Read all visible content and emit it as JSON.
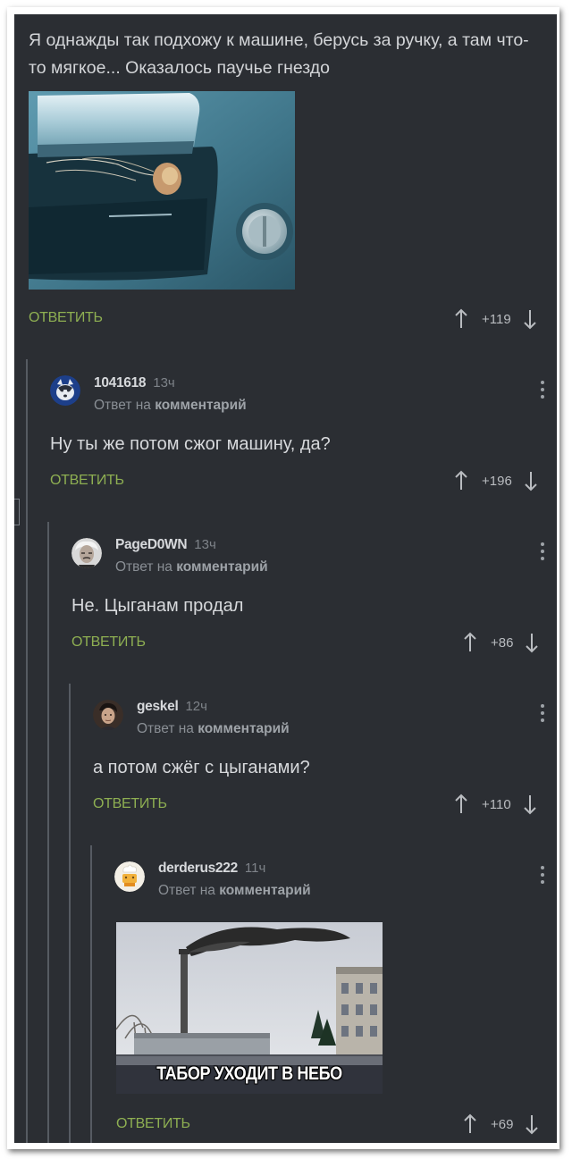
{
  "post": {
    "text": "Я однажды так подхожу к машине, берусь за ручку, а там что-то мягкое... Оказалось паучье гнездо",
    "reply_label": "ОТВЕТИТЬ",
    "rating": "+119"
  },
  "comments": [
    {
      "user": "1041618",
      "time": "13ч",
      "meta_prefix": "Ответ на",
      "meta_link": "комментарий",
      "text": "Ну ты же потом сжог машину, да?",
      "reply_label": "ОТВЕТИТЬ",
      "rating": "+196"
    },
    {
      "user": "PageD0WN",
      "time": "13ч",
      "meta_prefix": "Ответ на",
      "meta_link": "комментарий",
      "text": "Не. Цыганам продал",
      "reply_label": "ОТВЕТИТЬ",
      "rating": "+86"
    },
    {
      "user": "geskel",
      "time": "12ч",
      "meta_prefix": "Ответ на",
      "meta_link": "комментарий",
      "text": "а потом сжёг с цыганами?",
      "reply_label": "ОТВЕТИТЬ",
      "rating": "+110"
    },
    {
      "user": "derderus222",
      "time": "11ч",
      "meta_prefix": "Ответ на",
      "meta_link": "комментарий",
      "image_caption": "ТАБОР УХОДИТ В НЕБО",
      "reply_label": "ОТВЕТИТЬ",
      "rating": "+69"
    }
  ],
  "icons": {
    "upvote": "arrow-up-icon",
    "downvote": "arrow-down-icon",
    "menu": "more-vertical-icon"
  },
  "colors": {
    "background": "#2b2e33",
    "reply_link": "#8eaf52",
    "text": "#d7d9dc",
    "muted": "#8a8f95"
  }
}
